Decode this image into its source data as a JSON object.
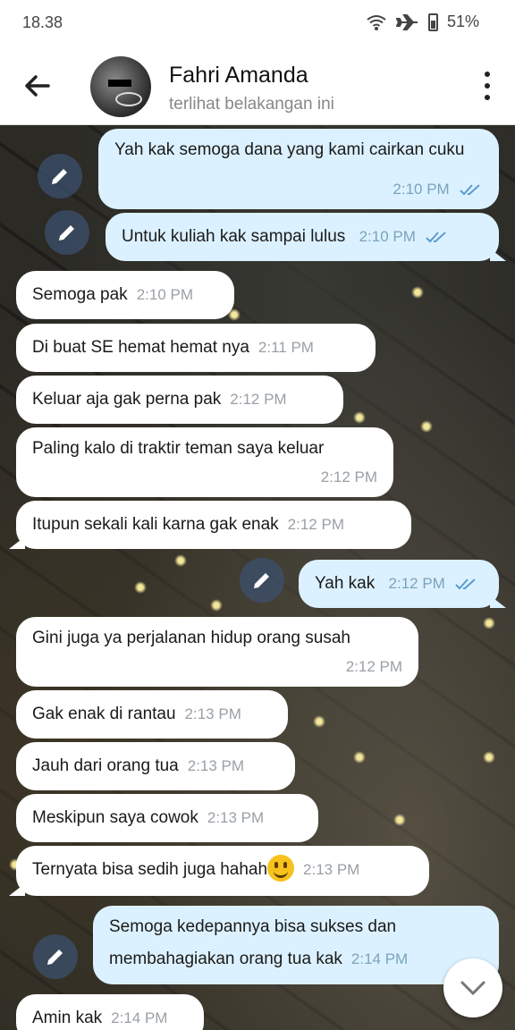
{
  "status": {
    "time": "18.38",
    "battery": "51%"
  },
  "header": {
    "name": "Fahri Amanda",
    "status": "terlihat belakangan ini"
  },
  "messages": [
    {
      "dir": "out",
      "text": "Yah kak semoga dana yang kami cairkan cuku",
      "time": "2:10 PM"
    },
    {
      "dir": "out",
      "text": "Untuk kuliah kak sampai lulus",
      "time": "2:10 PM"
    },
    {
      "dir": "in",
      "text": "Semoga pak",
      "time": "2:10 PM"
    },
    {
      "dir": "in",
      "text": "Di buat SE hemat hemat nya",
      "time": "2:11 PM"
    },
    {
      "dir": "in",
      "text": "Keluar aja gak perna pak",
      "time": "2:12 PM"
    },
    {
      "dir": "in",
      "text": "Paling kalo di traktir teman saya keluar",
      "time": "2:12 PM"
    },
    {
      "dir": "in",
      "text": "Itupun sekali kali karna gak enak",
      "time": "2:12 PM"
    },
    {
      "dir": "out",
      "text": "Yah kak",
      "time": "2:12 PM"
    },
    {
      "dir": "in",
      "text": "Gini juga ya perjalanan hidup orang susah",
      "time": "2:12 PM"
    },
    {
      "dir": "in",
      "text": "Gak enak di rantau",
      "time": "2:13 PM"
    },
    {
      "dir": "in",
      "text": "Jauh dari orang tua",
      "time": "2:13 PM"
    },
    {
      "dir": "in",
      "text": "Meskipun saya cowok",
      "time": "2:13 PM"
    },
    {
      "dir": "in",
      "text": "Ternyata bisa sedih juga hahah",
      "time": "2:13 PM"
    },
    {
      "dir": "out",
      "text": "Semoga kedepannya bisa sukses dan membahagiakan orang tua kak",
      "time": "2:14 PM"
    },
    {
      "dir": "in",
      "text": "Amin kak",
      "time": "2:14 PM"
    }
  ]
}
